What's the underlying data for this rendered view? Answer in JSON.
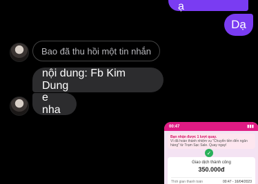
{
  "messages": {
    "outgoing_top": "Giờ e về sao ạ",
    "outgoing_reply": "Dạ",
    "recalled_notice": "Bao đã thu hồi một tin nhắn",
    "incoming_1": "nội dung: Fb Kim Dung",
    "incoming_2": "e nha"
  },
  "screenshot": {
    "time": "00:47",
    "notice_title": "Bạn nhận được 1 lượt quay.",
    "notice_body": "Vì đã hoàn thành nhiệm vụ \"Chuyển tiền đến ngân hàng\" từ Trạm Sạc Sale. Quay ngay!",
    "status_text": "Giao dịch thành công",
    "amount": "350.000đ",
    "row_label": "Thời gian thanh toán",
    "row_value": "00:47 - 16/04/2023"
  },
  "colors": {
    "outgoing_bubble": "#7a3cf2",
    "incoming_bubble": "#2c2c2e",
    "background": "#000000"
  }
}
